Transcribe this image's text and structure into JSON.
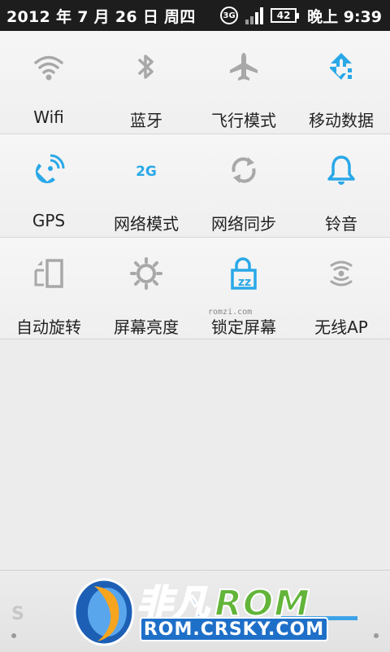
{
  "status_bar": {
    "date": "2012 年 7 月 26 日 周四",
    "network": "3G",
    "battery": "42",
    "time": "晚上 9:39"
  },
  "toggles": [
    {
      "label": "Wifi",
      "icon": "wifi-icon",
      "active": false
    },
    {
      "label": "蓝牙",
      "icon": "bluetooth-icon",
      "active": false
    },
    {
      "label": "飞行模式",
      "icon": "airplane-icon",
      "active": false
    },
    {
      "label": "移动数据",
      "icon": "mobile-data-icon",
      "active": true
    },
    {
      "label": "GPS",
      "icon": "gps-satellite-icon",
      "active": true
    },
    {
      "label": "网络模式",
      "icon": "network-2g-icon",
      "icon_text": "2G",
      "active": true
    },
    {
      "label": "网络同步",
      "icon": "sync-icon",
      "active": false
    },
    {
      "label": "铃音",
      "icon": "bell-icon",
      "active": true
    },
    {
      "label": "自动旋转",
      "icon": "auto-rotate-icon",
      "active": false
    },
    {
      "label": "屏幕亮度",
      "icon": "brightness-icon",
      "active": false
    },
    {
      "label": "锁定屏幕",
      "icon": "lock-screen-icon",
      "active": true
    },
    {
      "label": "无线AP",
      "icon": "wireless-ap-icon",
      "active": false
    }
  ],
  "colors": {
    "active": "#29a8e8",
    "inactive": "#a8a8a8",
    "status_bg": "#1d1d1d"
  },
  "watermark": {
    "small_text": "romzi.com",
    "brand_cn": "非凡",
    "brand_rom": "ROM",
    "brand_url": "ROM.CRSKY.COM",
    "ghost_text": "S"
  }
}
